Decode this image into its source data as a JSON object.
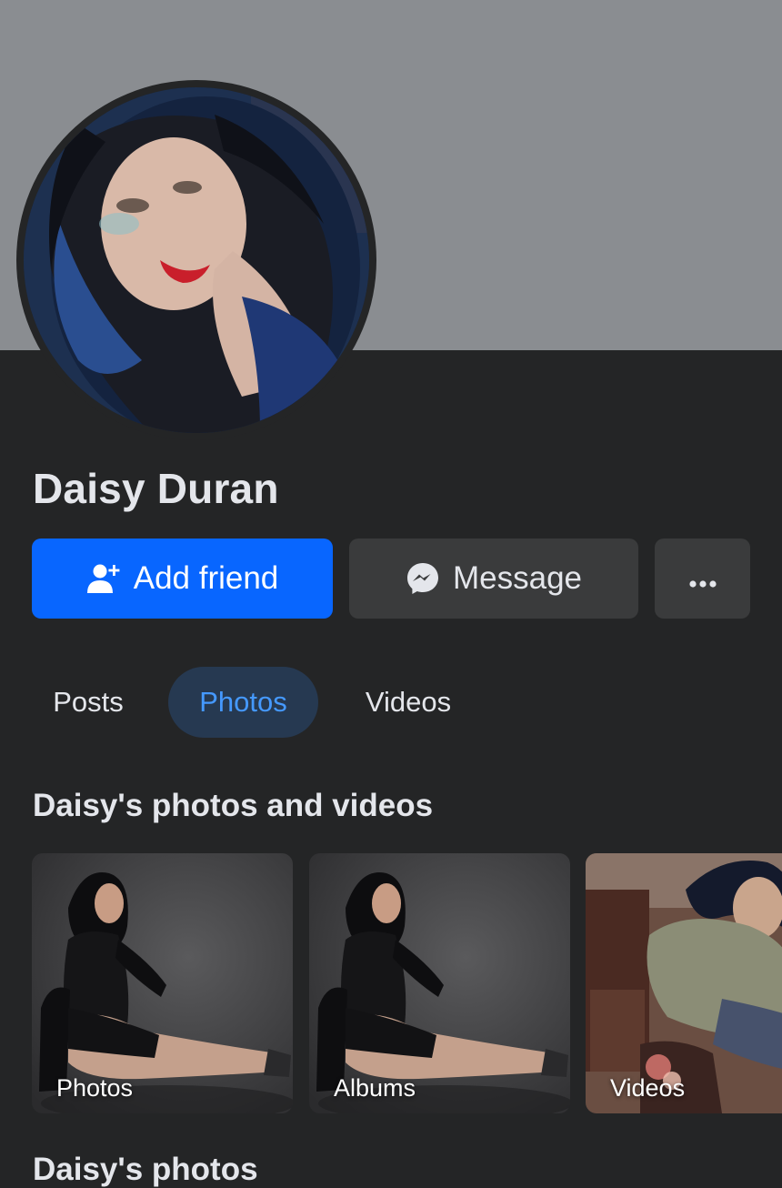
{
  "profile": {
    "name": "Daisy Duran"
  },
  "actions": {
    "add_friend": "Add friend",
    "message": "Message",
    "more": "•••"
  },
  "tabs": [
    {
      "label": "Posts",
      "active": false
    },
    {
      "label": "Photos",
      "active": true
    },
    {
      "label": "Videos",
      "active": false
    }
  ],
  "media": {
    "title": "Daisy's photos and videos",
    "tiles": [
      {
        "label": "Photos"
      },
      {
        "label": "Albums"
      },
      {
        "label": "Videos"
      }
    ]
  },
  "next_section": {
    "title": "Daisy's photos"
  },
  "colors": {
    "primary": "#0866ff",
    "background": "#242526",
    "cover": "#8a8d91",
    "tab_active_bg": "#263951",
    "tab_active_text": "#4599ff",
    "secondary_button": "#3a3b3c"
  },
  "icons": {
    "add_friend": "person-plus-icon",
    "message": "messenger-icon",
    "more": "more-dots-icon"
  }
}
